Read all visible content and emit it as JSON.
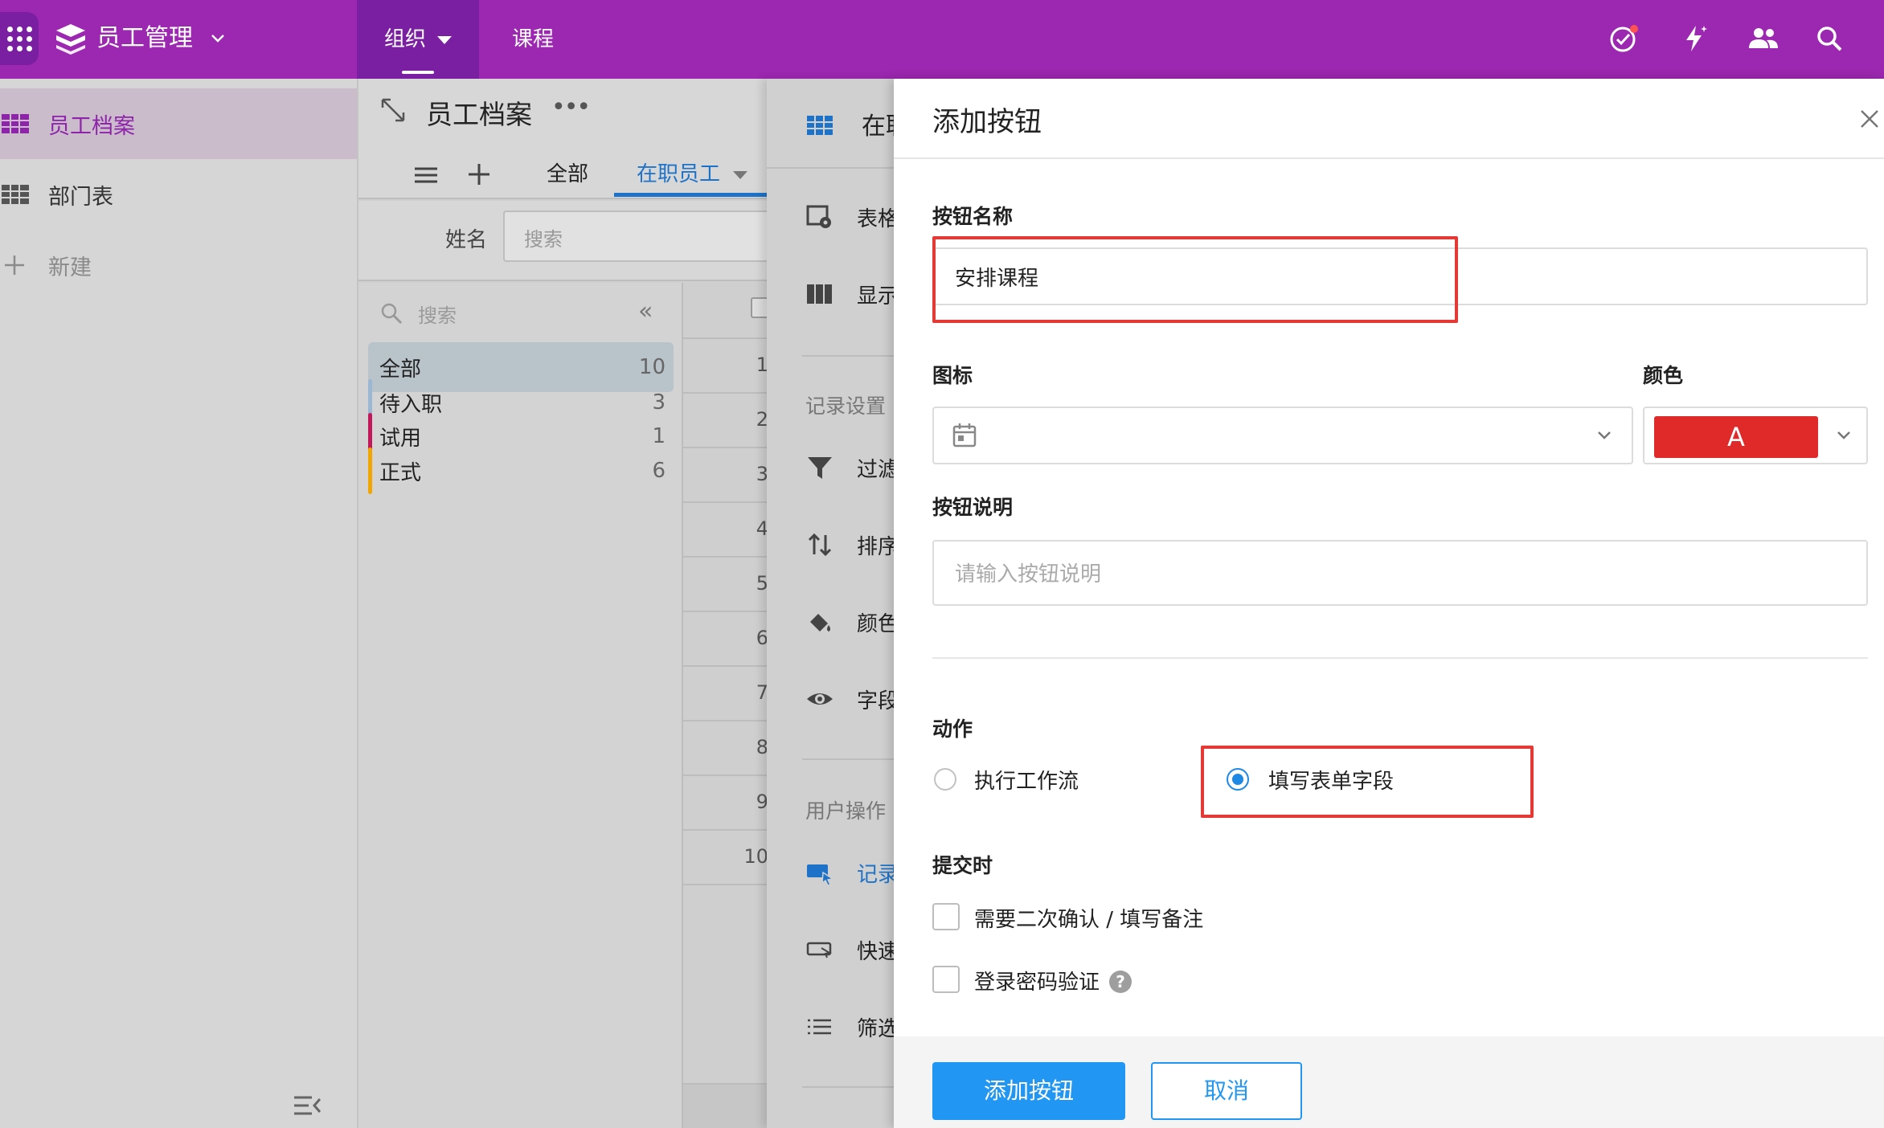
{
  "topbar": {
    "app_title": "员工管理",
    "tabs": [
      {
        "label": "组织",
        "active": true
      },
      {
        "label": "课程",
        "active": false
      }
    ],
    "icons": [
      "task-check-icon",
      "magic-bolt-icon",
      "people-icon",
      "search-icon"
    ],
    "colors": {
      "bar": "#9c27b0",
      "active_tab": "#7b1fa2"
    }
  },
  "sidebar": {
    "items": [
      {
        "label": "员工档案",
        "active": true
      },
      {
        "label": "部门表",
        "active": false
      }
    ],
    "new_label": "新建"
  },
  "page": {
    "title": "员工档案",
    "views": {
      "all": "全部",
      "current": "在职员工"
    },
    "filter": {
      "label": "姓名",
      "placeholder": "搜索"
    },
    "groups": {
      "search_placeholder": "搜索",
      "items": [
        {
          "label": "全部",
          "count": "10",
          "color": "#b9c3ca"
        },
        {
          "label": "待入职",
          "count": "3",
          "color": "#9bb7d3"
        },
        {
          "label": "试用",
          "count": "1",
          "color": "#c2185b"
        },
        {
          "label": "正式",
          "count": "6",
          "color": "#f0a500"
        }
      ]
    },
    "row_numbers": [
      "1",
      "2",
      "3",
      "4",
      "5",
      "6",
      "7",
      "8",
      "9",
      "10"
    ]
  },
  "settings": {
    "header": "在职员工",
    "items_top": [
      {
        "label": "表格视图",
        "icon": "table-eye-icon"
      },
      {
        "label": "显示列",
        "icon": "columns-icon"
      }
    ],
    "record_section": "记录设置",
    "record_items": [
      {
        "label": "过滤",
        "icon": "filter-icon"
      },
      {
        "label": "排序",
        "icon": "sort-icon"
      },
      {
        "label": "颜色",
        "icon": "paint-bucket-icon"
      },
      {
        "label": "字段",
        "icon": "eye-icon"
      }
    ],
    "user_section": "用户操作",
    "user_items": [
      {
        "label": "记录",
        "icon": "record-click-icon",
        "active": true
      },
      {
        "label": "快速",
        "icon": "quick-action-icon",
        "active": false
      },
      {
        "label": "筛选",
        "icon": "list-icon",
        "active": false
      }
    ]
  },
  "modal": {
    "title": "添加按钮",
    "name_label": "按钮名称",
    "name_value": "安排课程",
    "icon_label": "图标",
    "color_label": "颜色",
    "color_value": "#e02a2a",
    "color_letter": "A",
    "desc_label": "按钮说明",
    "desc_placeholder": "请输入按钮说明",
    "action_label": "动作",
    "actions": [
      {
        "label": "执行工作流",
        "selected": false
      },
      {
        "label": "填写表单字段",
        "selected": true
      }
    ],
    "submit_label": "提交时",
    "submit_options": [
      {
        "label": "需要二次确认 / 填写备注",
        "checked": false
      },
      {
        "label": "登录密码验证",
        "checked": false
      }
    ],
    "help_glyph": "?",
    "confirm_button": "添加按钮",
    "cancel_button": "取消"
  }
}
